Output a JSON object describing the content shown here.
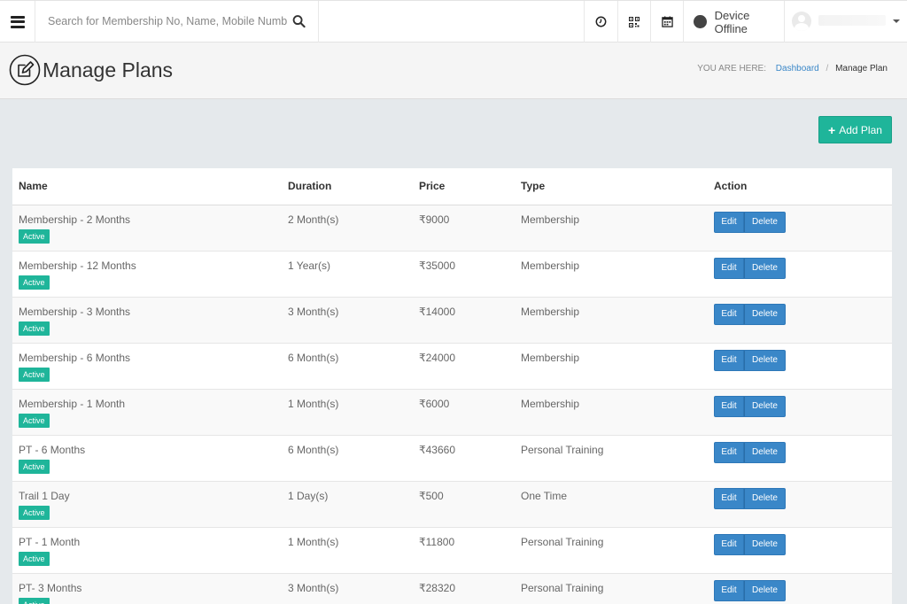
{
  "search": {
    "placeholder": "Search for Membership No, Name, Mobile Number"
  },
  "topbar": {
    "device_status": "Device Offline"
  },
  "header": {
    "title": "Manage Plans",
    "breadcrumb_label": "YOU ARE HERE:",
    "breadcrumb_link": "Dashboard",
    "breadcrumb_separator": "/",
    "breadcrumb_current": "Manage Plan"
  },
  "toolbar": {
    "add_plan_label": "Add Plan",
    "add_plan_icon": "+"
  },
  "table": {
    "headers": {
      "name": "Name",
      "duration": "Duration",
      "price": "Price",
      "type": "Type",
      "action": "Action"
    },
    "edit_label": "Edit",
    "delete_label": "Delete",
    "rows": [
      {
        "name": "Membership - 2 Months",
        "status": "Active",
        "duration": "2 Month(s)",
        "price": "₹9000",
        "type": "Membership"
      },
      {
        "name": "Membership - 12 Months",
        "status": "Active",
        "duration": "1 Year(s)",
        "price": "₹35000",
        "type": "Membership"
      },
      {
        "name": "Membership - 3 Months",
        "status": "Active",
        "duration": "3 Month(s)",
        "price": "₹14000",
        "type": "Membership"
      },
      {
        "name": "Membership - 6 Months",
        "status": "Active",
        "duration": "6 Month(s)",
        "price": "₹24000",
        "type": "Membership"
      },
      {
        "name": "Membership - 1 Month",
        "status": "Active",
        "duration": "1 Month(s)",
        "price": "₹6000",
        "type": "Membership"
      },
      {
        "name": "PT - 6 Months",
        "status": "Active",
        "duration": "6 Month(s)",
        "price": "₹43660",
        "type": "Personal Training"
      },
      {
        "name": "Trail 1 Day",
        "status": "Active",
        "duration": "1 Day(s)",
        "price": "₹500",
        "type": "One Time"
      },
      {
        "name": "PT - 1 Month",
        "status": "Active",
        "duration": "1 Month(s)",
        "price": "₹11800",
        "type": "Personal Training"
      },
      {
        "name": "PT- 3 Months",
        "status": "Active",
        "duration": "3 Month(s)",
        "price": "₹28320",
        "type": "Personal Training"
      }
    ]
  },
  "colors": {
    "accent_green": "#1fb59a",
    "action_blue": "#3a87c8"
  }
}
